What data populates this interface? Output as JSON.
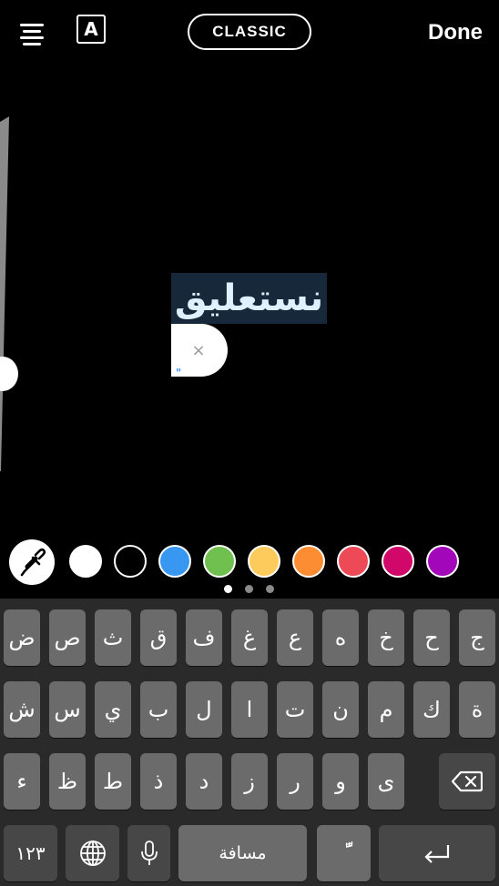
{
  "topbar": {
    "text_style_icon": "A",
    "font_style_button": "CLASSIC",
    "done_label": "Done"
  },
  "editor": {
    "text": "نستعليق",
    "clear_icon": "×",
    "cursor_glyph": "\""
  },
  "palette": {
    "colors": [
      "#ffffff",
      "#000000",
      "#3897f0",
      "#70c050",
      "#fdcb5c",
      "#fd8d32",
      "#ed4956",
      "#d10869",
      "#a307ba"
    ],
    "page_indicator": {
      "pages": 3,
      "current": 1
    }
  },
  "keyboard": {
    "row1": [
      "ض",
      "ص",
      "ث",
      "ق",
      "ف",
      "غ",
      "ع",
      "ه",
      "خ",
      "ح",
      "ج"
    ],
    "row2": [
      "ش",
      "س",
      "ي",
      "ب",
      "ل",
      "ا",
      "ت",
      "ن",
      "م",
      "ك",
      "ة"
    ],
    "row3": [
      "ء",
      "ظ",
      "ط",
      "ذ",
      "د",
      "ز",
      "ر",
      "و",
      "ى"
    ],
    "numbers_label": "١٢٣",
    "space_label": "مسافة",
    "diacritic_label": "ًّ",
    "icons": {
      "backspace": "backspace-icon",
      "globe": "globe-icon",
      "mic": "microphone-icon",
      "return": "return-icon"
    }
  }
}
